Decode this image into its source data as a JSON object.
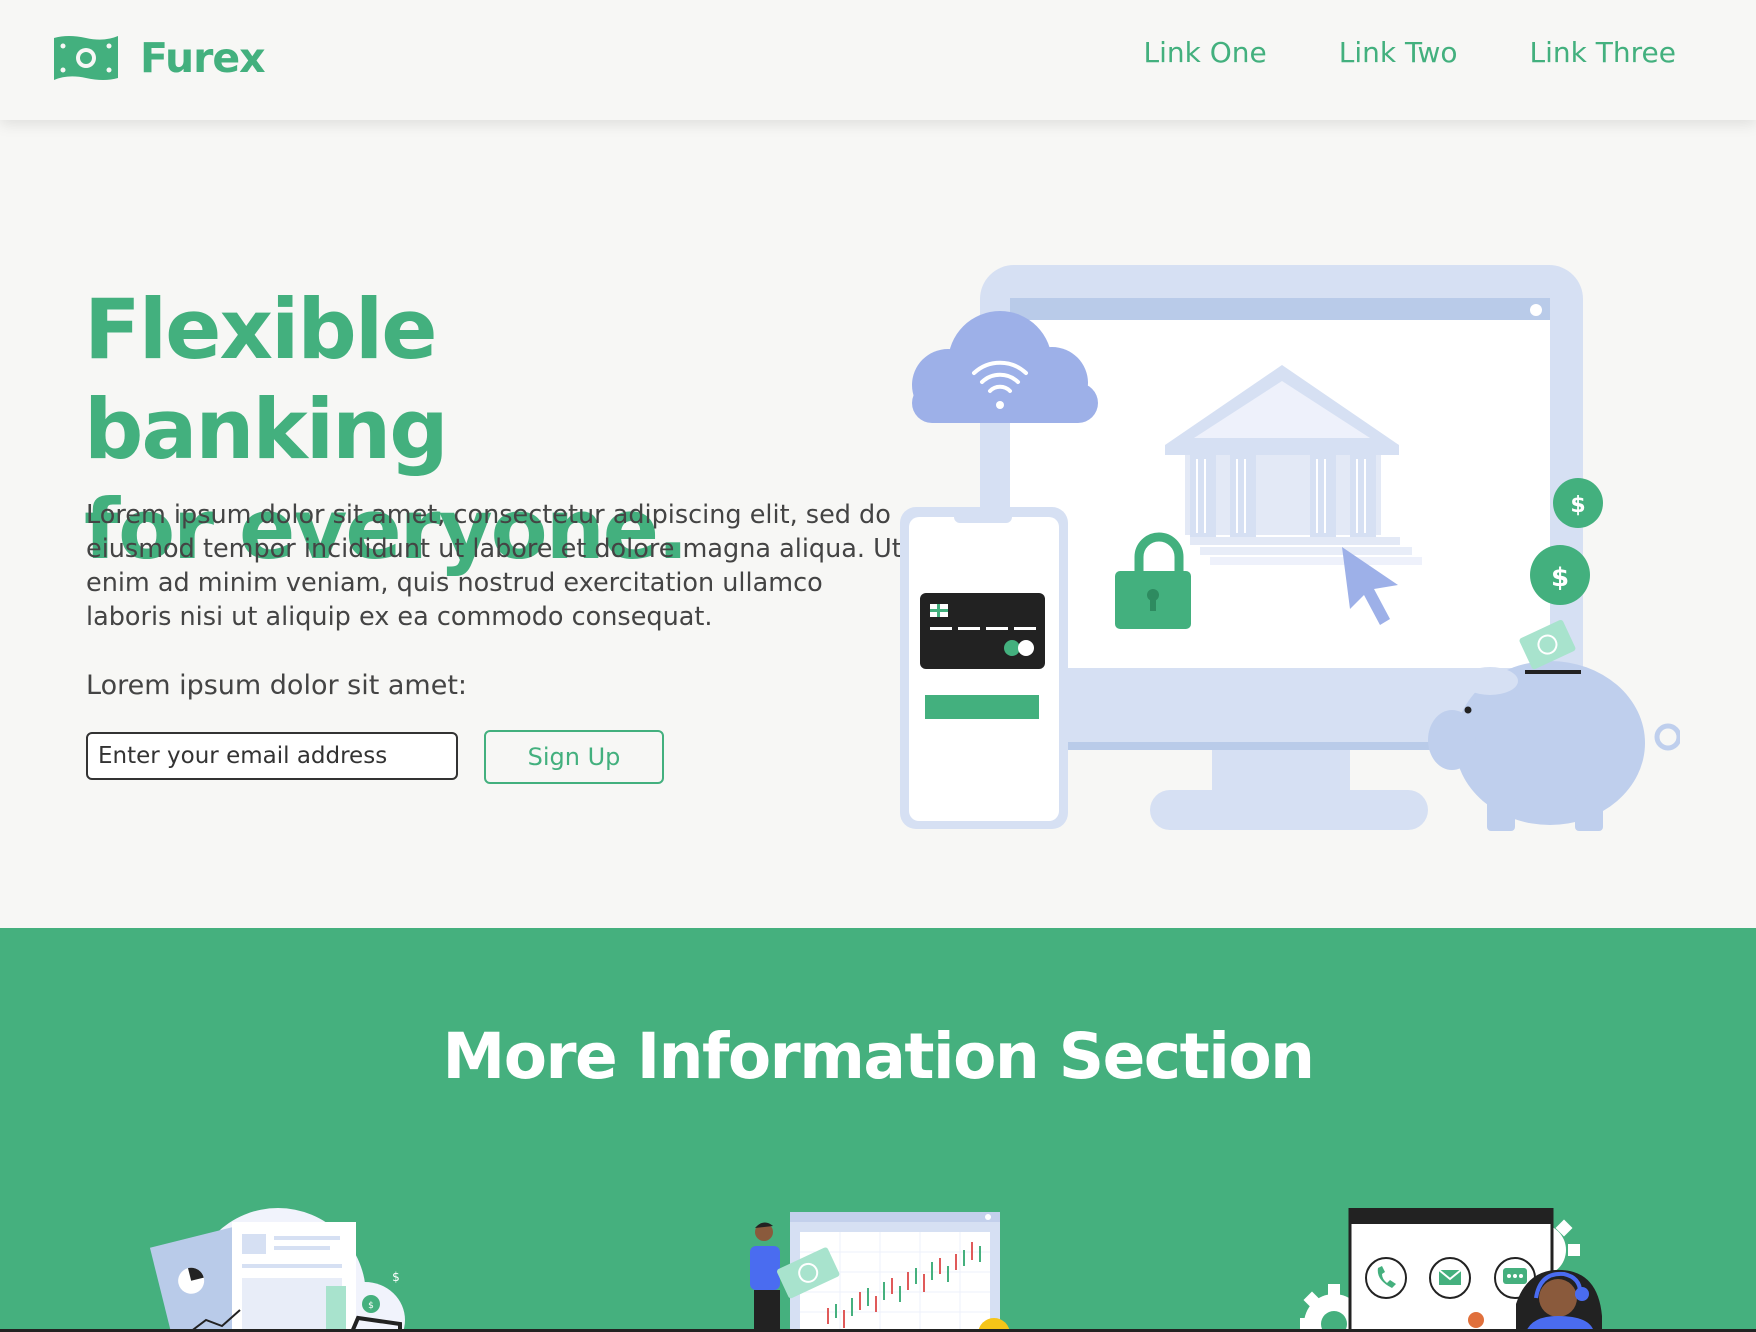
{
  "nav": {
    "brand": "Furex",
    "links": [
      "Link One",
      "Link Two",
      "Link Three"
    ]
  },
  "hero": {
    "title_line1": "Flexible banking",
    "title_line2": "for everyone.",
    "paragraph": "Lorem ipsum dolor sit amet, consectetur adipiscing elit, sed do eiusmod tempor incididunt ut labore et dolore magna aliqua. Ut enim ad minim veniam, quis nostrud exercitation ullamco laboris nisi ut aliquip ex ea commodo consequat.",
    "subheading": "Lorem ipsum dolor sit amet:",
    "email_placeholder": "Enter your email address",
    "signup_label": "Sign Up"
  },
  "info": {
    "title": "More Information Section"
  },
  "colors": {
    "brand_green": "#43b07e",
    "section_green": "#45b07e",
    "page_bg": "#f7f7f5",
    "illustration_blue": "#d6e0f3"
  },
  "icons": [
    "money-bill-icon",
    "wifi-icon",
    "lock-icon",
    "cursor-icon",
    "dollar-coin-icon",
    "credit-card-icon",
    "phone-icon",
    "mail-icon",
    "chat-icon",
    "gear-icon"
  ]
}
